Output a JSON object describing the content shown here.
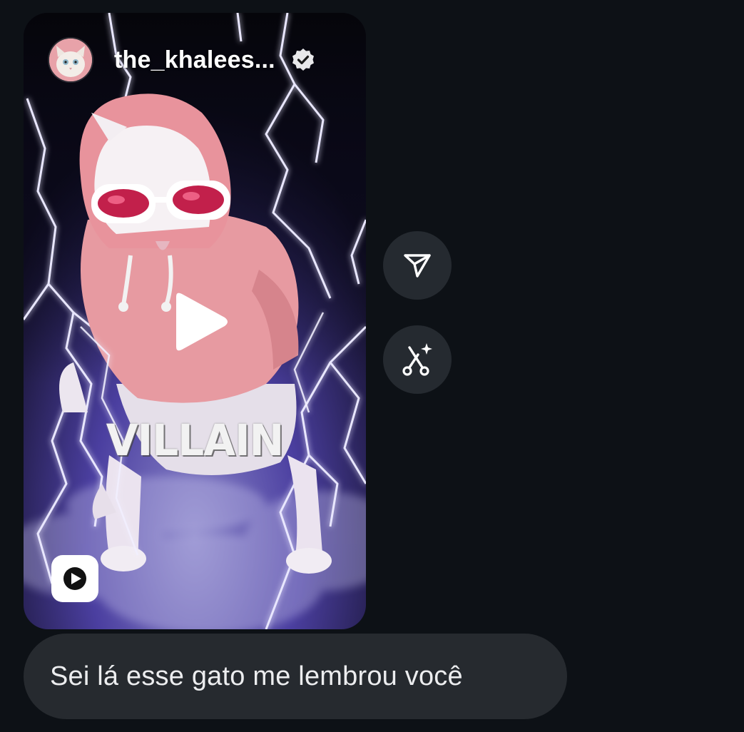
{
  "shared_reel": {
    "username": "the_khalees...",
    "verified": true,
    "overlay_text": "VILLAIN",
    "avatar_icon": "cat-avatar",
    "play_icon": "play-icon",
    "reel_type_icon": "reels-icon"
  },
  "actions": [
    {
      "icon": "share-send-icon"
    },
    {
      "icon": "remix-sparkle-icon"
    }
  ],
  "message": {
    "text": "Sei lá esse gato me lembrou você"
  },
  "colors": {
    "background": "#0d1116",
    "bubble": "#262a2f",
    "action_button": "#252a30",
    "lightning": "#b9b4ff",
    "hoodie": "#e79aa1"
  }
}
